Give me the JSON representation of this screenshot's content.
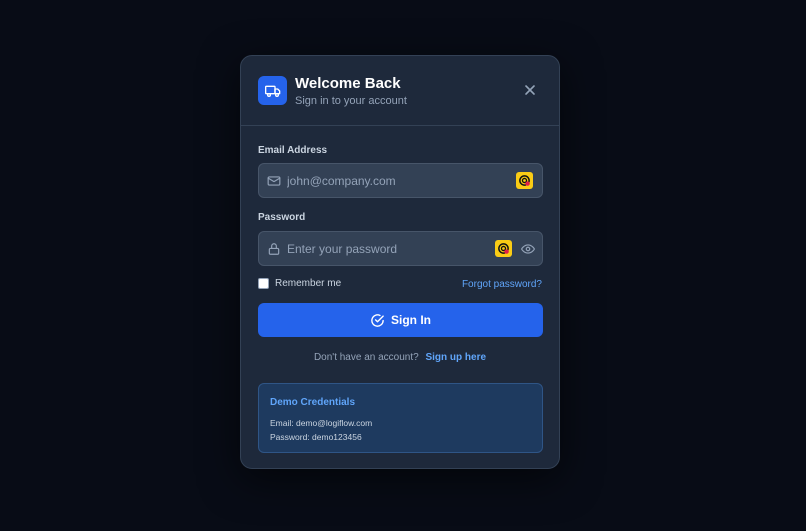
{
  "header": {
    "title": "Welcome Back",
    "subtitle": "Sign in to your account",
    "logo_icon": "truck-icon",
    "close_icon": "close-icon"
  },
  "form": {
    "email": {
      "label": "Email Address",
      "value": "",
      "placeholder": "john@company.com",
      "icon": "mail-icon"
    },
    "password": {
      "label": "Password",
      "value": "",
      "placeholder": "Enter your password",
      "icon": "lock-icon",
      "toggle_icon": "eye-icon"
    },
    "remember_label": "Remember me",
    "remember_checked": false,
    "forgot_label": "Forgot password?",
    "submit_label": "Sign In",
    "submit_icon": "check-circle-icon"
  },
  "signup": {
    "prompt": "Don't have an account?",
    "link": "Sign up here"
  },
  "demo": {
    "title": "Demo Credentials",
    "email_line": "Email: demo@logiflow.com",
    "password_line": "Password: demo123456"
  },
  "colors": {
    "background": "#080c16",
    "modal": "#1e293b",
    "accent": "#2563eb",
    "link": "#60a5fa",
    "extension_badge": "#facc15"
  }
}
